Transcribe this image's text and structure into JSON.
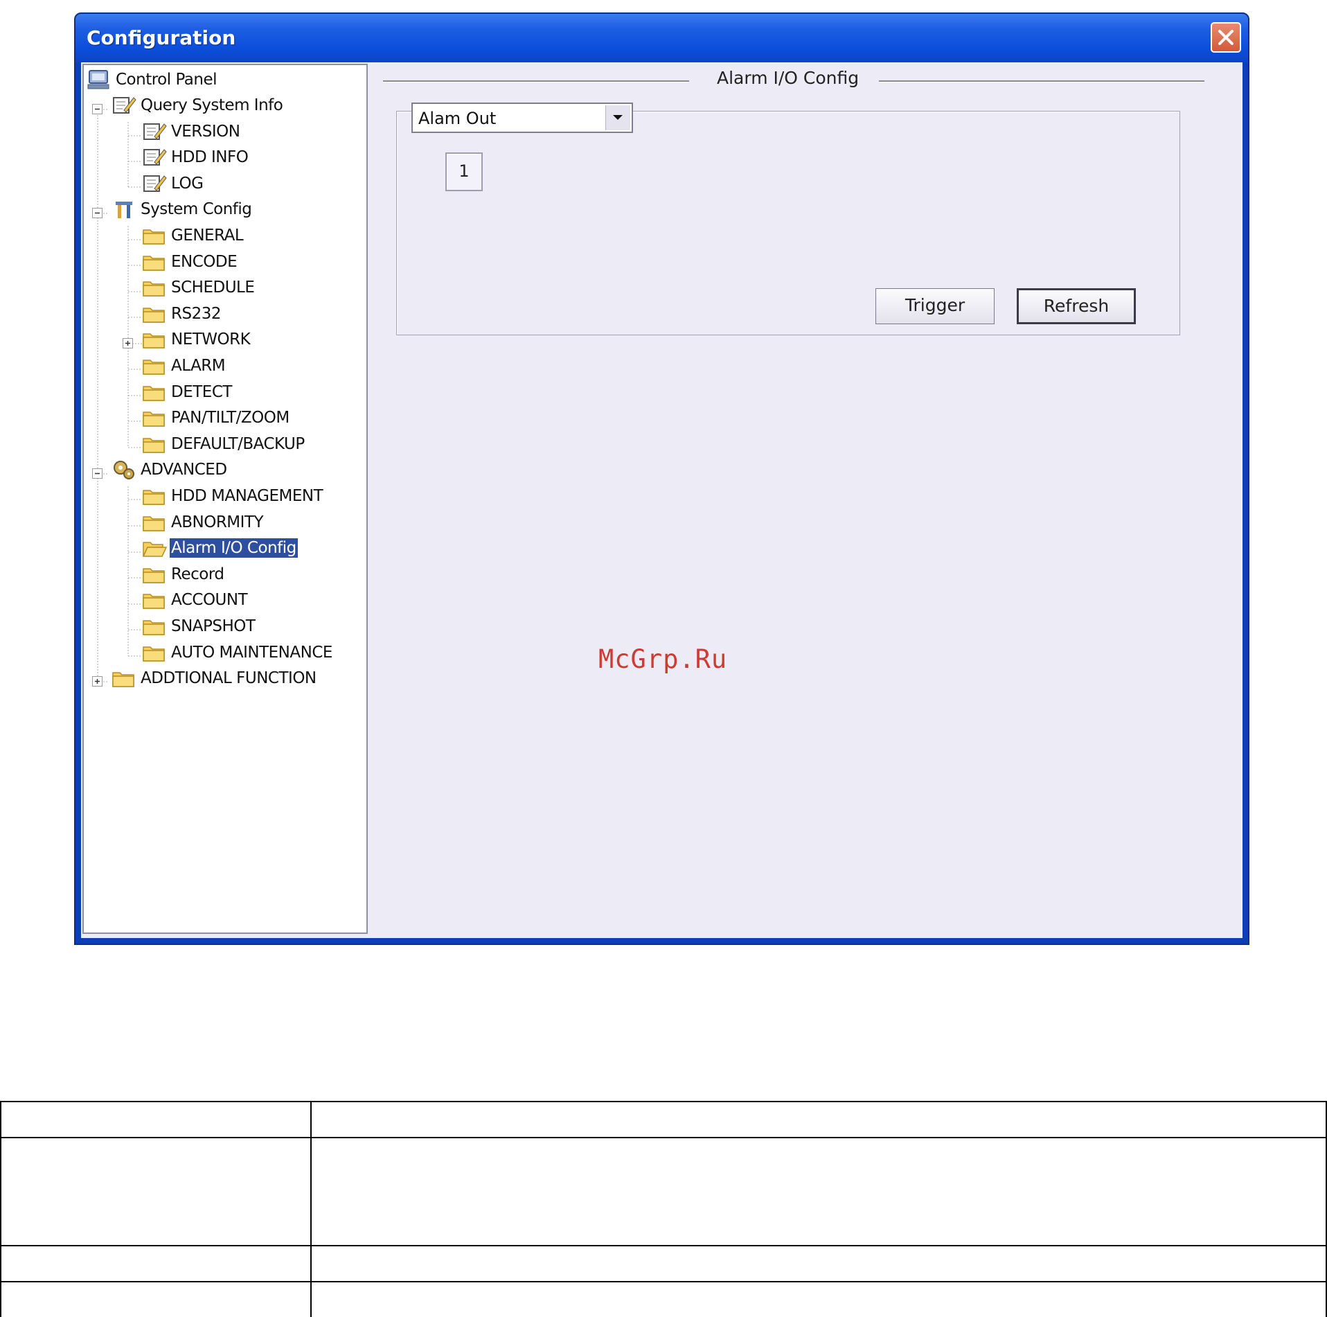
{
  "window": {
    "title": "Configuration"
  },
  "tree": {
    "root": "Control Panel",
    "groups": [
      {
        "label": "Query System Info",
        "expanded": true,
        "icon": "notepad-icon",
        "items": [
          "VERSION",
          "HDD INFO",
          "LOG"
        ]
      },
      {
        "label": "System Config",
        "expanded": true,
        "icon": "tools-icon",
        "items": [
          "GENERAL",
          "ENCODE",
          "SCHEDULE",
          "RS232",
          "NETWORK",
          "ALARM",
          "DETECT",
          "PAN/TILT/ZOOM",
          "DEFAULT/BACKUP"
        ]
      },
      {
        "label": "ADVANCED",
        "expanded": true,
        "icon": "gears-icon",
        "items": [
          "HDD MANAGEMENT",
          "ABNORMITY",
          "Alarm I/O Config",
          "Record",
          "ACCOUNT",
          "SNAPSHOT",
          "AUTO MAINTENANCE"
        ]
      },
      {
        "label": "ADDTIONAL FUNCTION",
        "expanded": false,
        "icon": "folder-icon",
        "items": []
      }
    ],
    "selected": "Alarm I/O Config"
  },
  "panel": {
    "title": "Alarm I/O Config",
    "select_value": "Alam Out",
    "channel": "1",
    "trigger_label": "Trigger",
    "refresh_label": "Refresh"
  },
  "watermark": "McGrp.Ru",
  "colors": {
    "titlebar": "#1f5ee2",
    "selection": "#2d4f9e",
    "panel_bg": "#ecebf6",
    "watermark": "#d03a32"
  },
  "table": {
    "rows": [
      [
        "",
        ""
      ],
      [
        "",
        ""
      ],
      [
        "",
        ""
      ],
      [
        "",
        ""
      ]
    ]
  }
}
